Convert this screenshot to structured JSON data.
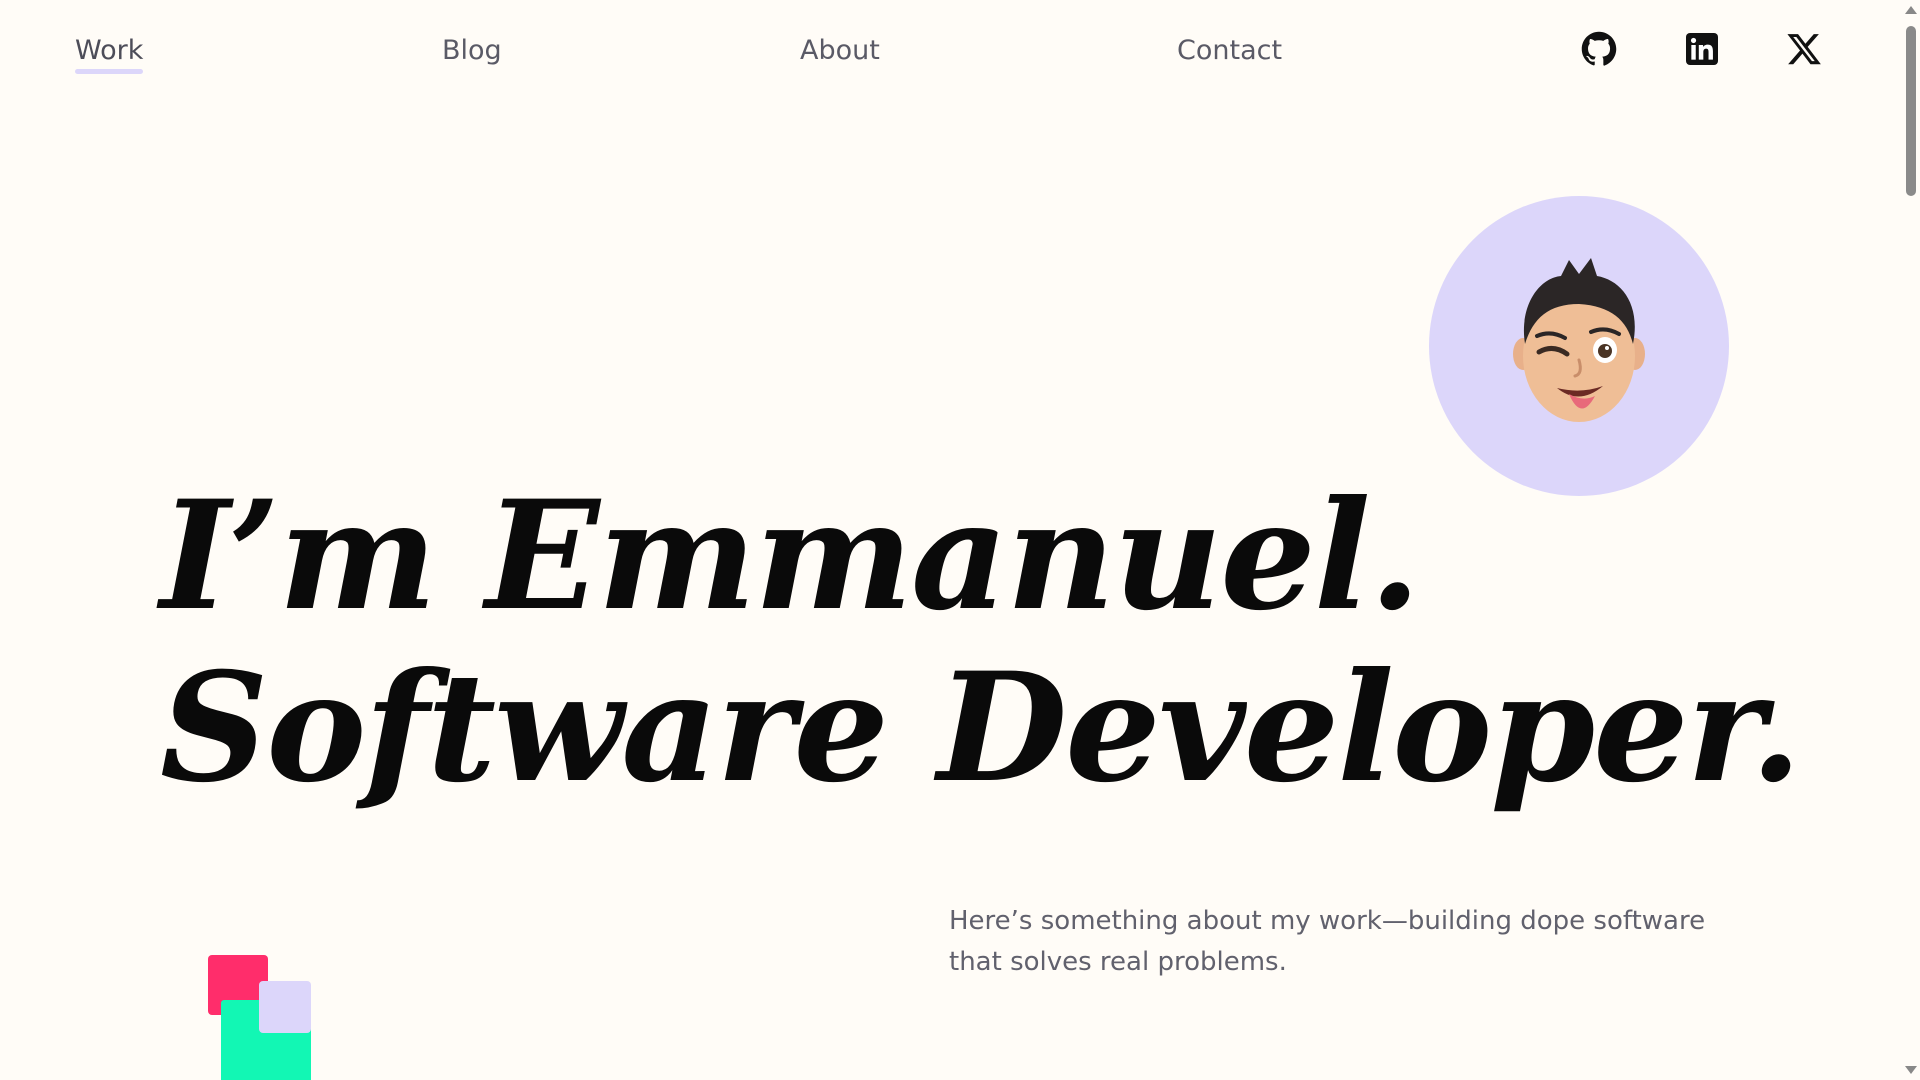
{
  "nav": {
    "items": [
      {
        "label": "Work",
        "active": true
      },
      {
        "label": "Blog",
        "active": false
      },
      {
        "label": "About",
        "active": false
      },
      {
        "label": "Contact",
        "active": false
      }
    ],
    "social": [
      {
        "name": "github-icon"
      },
      {
        "name": "linkedin-icon"
      },
      {
        "name": "x-icon"
      }
    ]
  },
  "hero": {
    "line1": "I’m Emmanuel.",
    "line2": "Software Developer.",
    "intro": "Here’s something about my work—building dope software that solves real problems."
  },
  "colors": {
    "background": "#FFFCF7",
    "accent_lavender": "#DCD6FA",
    "square_red": "#FF2D6B",
    "square_green": "#12F7B4"
  }
}
